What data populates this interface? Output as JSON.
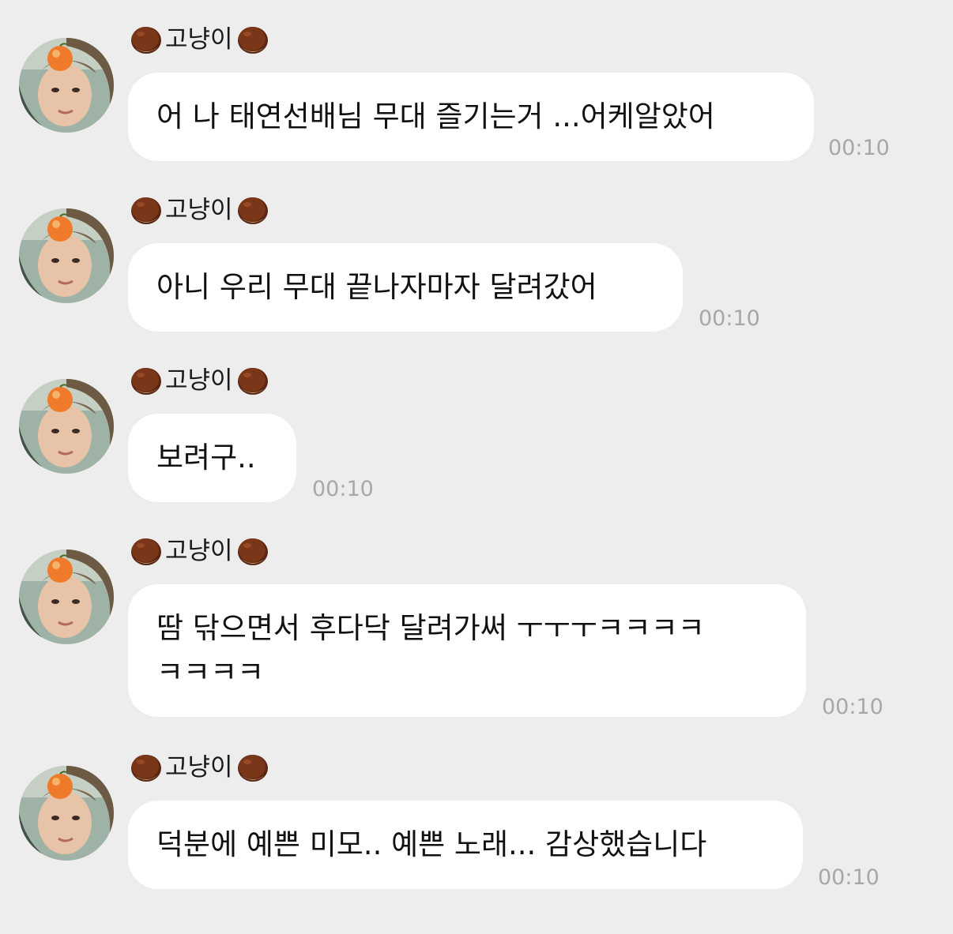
{
  "sender": {
    "name": "고냥이",
    "name_prefix_icon": "chestnut-icon",
    "name_suffix_icon": "chestnut-icon",
    "avatar": "profile-photo-avatar"
  },
  "messages": [
    {
      "text": "어 나 태연선배님 무대 즐기는거 ...어케알았어",
      "time": "00:10"
    },
    {
      "text": "아니 우리 무대 끝나자마자 달려갔어",
      "time": "00:10"
    },
    {
      "text": "보려구..",
      "time": "00:10"
    },
    {
      "text": "땀 닦으면서 후다닥 달려가써 ㅜㅜㅜㅋㅋㅋㅋ ㅋㅋㅋㅋ",
      "time": "00:10"
    },
    {
      "text": "덕분에 예쁜 미모.. 예쁜 노래... 감상했습니다",
      "time": "00:10"
    }
  ],
  "colors": {
    "background": "#ededed",
    "bubble": "#ffffff",
    "timestamp": "#a7a7a7",
    "chestnut": "#6b2f16"
  }
}
